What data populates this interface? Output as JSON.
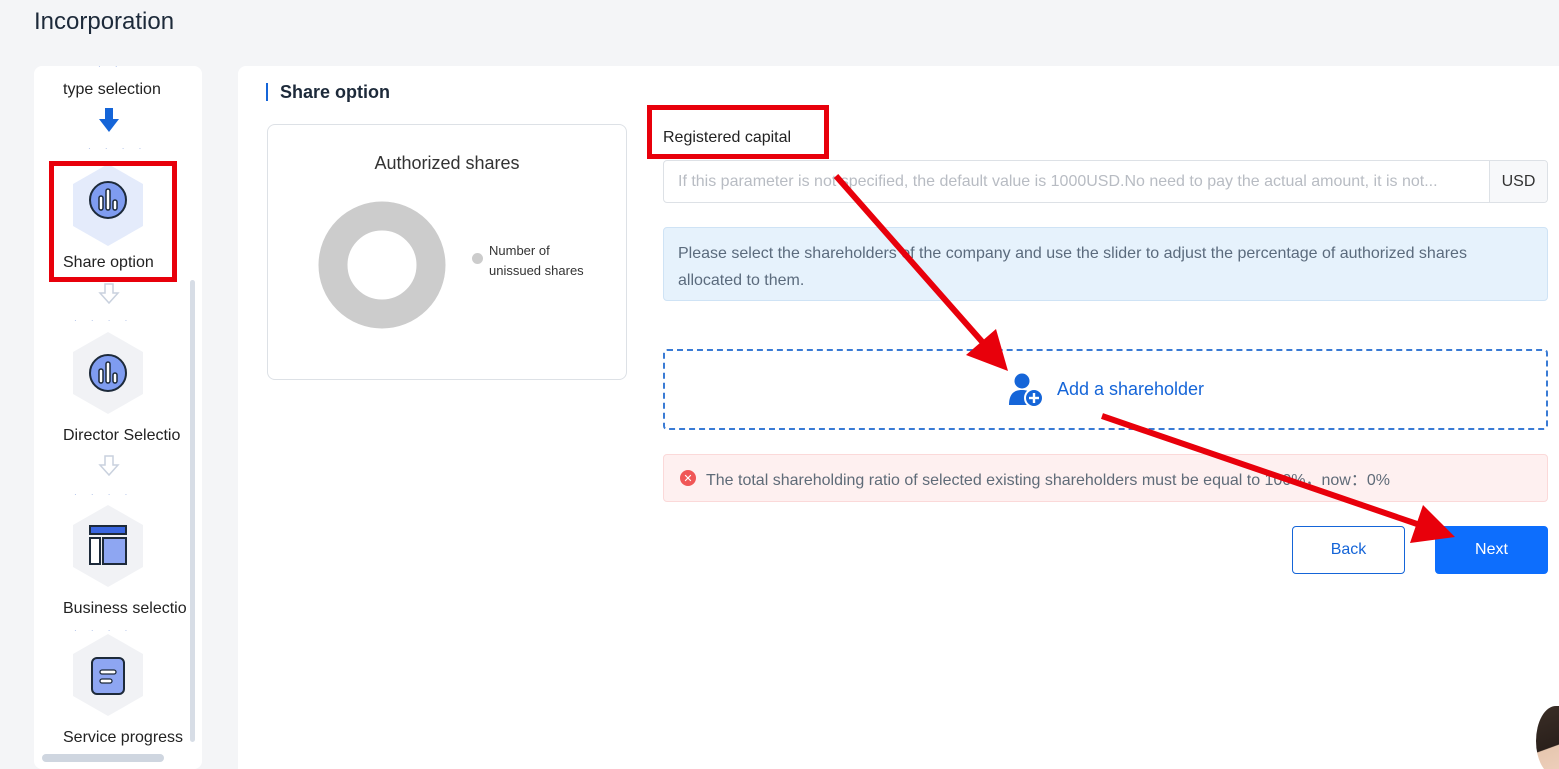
{
  "page": {
    "title": "Incorporation"
  },
  "sidebar": {
    "steps": [
      {
        "label": "type selection",
        "icon": "arrow-down-icon"
      },
      {
        "label": "Share option",
        "icon": "bar-chart-icon",
        "active": true
      },
      {
        "label": "Director Selectio",
        "icon": "bar-chart-icon"
      },
      {
        "label": "Business selectio",
        "icon": "layout-icon"
      },
      {
        "label": "Service progress",
        "icon": "document-icon"
      }
    ]
  },
  "main": {
    "section_title": "Share option",
    "chart": {
      "title": "Authorized shares",
      "legend_label": "Number of unissued shares"
    },
    "chart_data": {
      "type": "pie",
      "title": "Authorized shares",
      "categories": [
        "Number of unissued shares"
      ],
      "values": [
        100
      ],
      "colors": [
        "#cccccc"
      ]
    },
    "registered_capital": {
      "label": "Registered capital",
      "placeholder": "If this parameter is not specified, the default value is 1000USD.No need to pay the actual amount, it is not...",
      "value": "",
      "unit": "USD"
    },
    "info_text": "Please select the shareholders of the company and use the slider to adjust the percentage of authorized shares allocated to them.",
    "add_shareholder_label": "Add a shareholder",
    "error_text": "The total shareholding ratio of selected existing shareholders must be equal to 100%，now：0%",
    "buttons": {
      "back": "Back",
      "next": "Next"
    }
  },
  "colors": {
    "primary": "#0d6efd",
    "link_blue": "#1565d8",
    "annotation_red": "#e8000b",
    "info_bg": "#e6f2fc",
    "error_bg": "#fef0f0",
    "error_icon": "#f05656"
  }
}
